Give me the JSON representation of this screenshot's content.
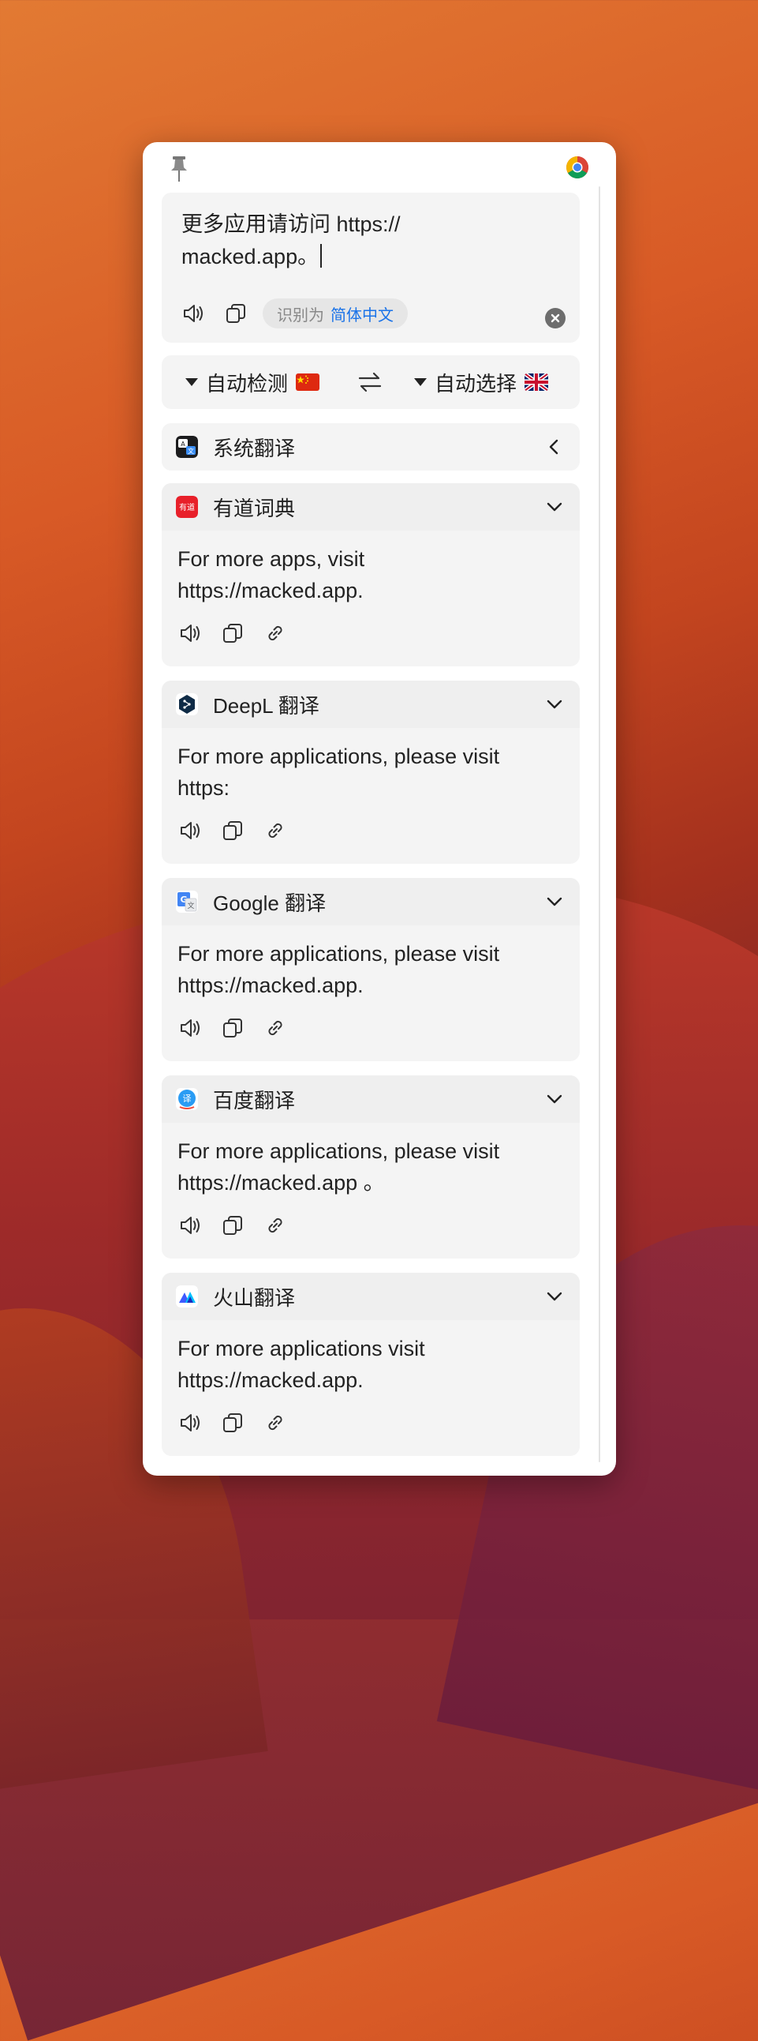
{
  "input": {
    "text": "更多应用请访问 https://macked.app。",
    "line1": "更多应用请访问 https://",
    "line2": "macked.app。",
    "detect_prefix": "识别为",
    "detect_language": "简体中文"
  },
  "language_bar": {
    "from_label": "自动检测",
    "to_label": "自动选择"
  },
  "services": [
    {
      "name": "系统翻译",
      "collapsed": true
    },
    {
      "name": "有道词典",
      "result": "For more apps, visit https://macked.app."
    },
    {
      "name": "DeepL 翻译",
      "result": "For more applications, please visit https:"
    },
    {
      "name": "Google 翻译",
      "result": "For more applications, please visit https://macked.app."
    },
    {
      "name": "百度翻译",
      "result": "For more applications, please visit https://macked.app 。"
    },
    {
      "name": "火山翻译",
      "result": "For more applications visit https://macked.app."
    }
  ],
  "colors": {
    "accent": "#1a73e8",
    "panel": "#f4f4f4",
    "youdao": "#e8202a",
    "deepl": "#0f2b46"
  },
  "icons": [
    "pin-icon",
    "chrome-icon",
    "speaker-icon",
    "copy-icon",
    "link-icon",
    "clear-icon",
    "swap-icon",
    "chevron-down-icon",
    "chevron-left-icon"
  ]
}
